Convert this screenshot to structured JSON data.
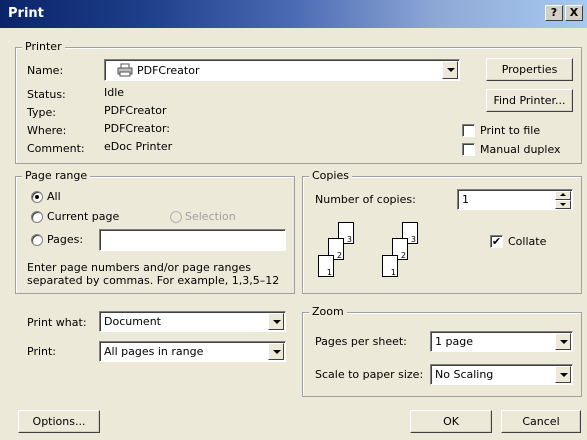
{
  "window": {
    "title": "Print",
    "help_label": "?",
    "close_label": "X"
  },
  "printer": {
    "group_label": "Printer",
    "name_label": "Name:",
    "name_value": "PDFCreator",
    "status_label": "Status:",
    "status_value": "Idle",
    "type_label": "Type:",
    "type_value": "PDFCreator",
    "where_label": "Where:",
    "where_value": "PDFCreator:",
    "comment_label": "Comment:",
    "comment_value": "eDoc Printer",
    "properties_button": "Properties",
    "find_printer_button": "Find Printer...",
    "print_to_file_label": "Print to file",
    "manual_duplex_label": "Manual duplex",
    "printer_icon": "printer-icon"
  },
  "page_range": {
    "group_label": "Page range",
    "all_label": "All",
    "current_page_label": "Current page",
    "selection_label": "Selection",
    "pages_label": "Pages:",
    "pages_value": "",
    "hint_line1": "Enter page numbers and/or page ranges",
    "hint_line2": "separated by commas.  For example, 1,3,5–12"
  },
  "copies": {
    "group_label": "Copies",
    "number_label": "Number of copies:",
    "number_value": "1",
    "collate_label": "Collate",
    "collate_checked": "✔",
    "stack1": [
      "1",
      "2",
      "3"
    ],
    "stack2": [
      "1",
      "2",
      "3"
    ]
  },
  "print_what": {
    "print_what_label": "Print what:",
    "print_what_value": "Document",
    "print_label": "Print:",
    "print_value": "All pages in range"
  },
  "zoom": {
    "group_label": "Zoom",
    "pages_per_sheet_label": "Pages per sheet:",
    "pages_per_sheet_value": "1 page",
    "scale_label": "Scale to paper size:",
    "scale_value": "No Scaling"
  },
  "footer": {
    "options_button": "Options...",
    "ok_button": "OK",
    "cancel_button": "Cancel"
  }
}
